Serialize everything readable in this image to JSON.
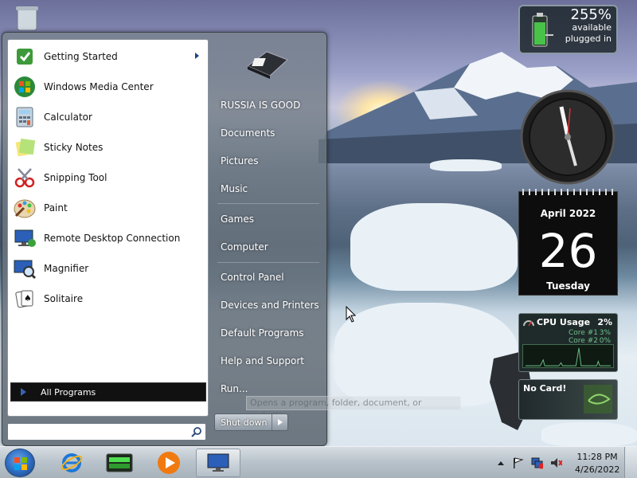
{
  "start_menu": {
    "programs": [
      {
        "label": "Getting Started",
        "icon": "getting-started-icon",
        "has_submenu": true
      },
      {
        "label": "Windows Media Center",
        "icon": "media-center-icon",
        "has_submenu": false
      },
      {
        "label": "Calculator",
        "icon": "calculator-icon",
        "has_submenu": false
      },
      {
        "label": "Sticky Notes",
        "icon": "sticky-notes-icon",
        "has_submenu": false
      },
      {
        "label": "Snipping Tool",
        "icon": "scissors-icon",
        "has_submenu": false
      },
      {
        "label": "Paint",
        "icon": "paint-palette-icon",
        "has_submenu": false
      },
      {
        "label": "Remote Desktop Connection",
        "icon": "remote-desktop-icon",
        "has_submenu": false
      },
      {
        "label": "Magnifier",
        "icon": "magnifier-icon",
        "has_submenu": false
      },
      {
        "label": "Solitaire",
        "icon": "playing-cards-icon",
        "has_submenu": false
      }
    ],
    "all_programs_label": "All Programs",
    "search_placeholder": "",
    "right_items": [
      {
        "label": "RUSSIA IS GOOD",
        "name": "user-name"
      },
      {
        "label": "Documents",
        "name": "documents"
      },
      {
        "label": "Pictures",
        "name": "pictures"
      },
      {
        "label": "Music",
        "name": "music"
      },
      {
        "label": "Games",
        "name": "games"
      },
      {
        "label": "Computer",
        "name": "computer"
      },
      {
        "label": "Control Panel",
        "name": "control-panel"
      },
      {
        "label": "Devices and Printers",
        "name": "devices-and-printers"
      },
      {
        "label": "Default Programs",
        "name": "default-programs"
      },
      {
        "label": "Help and Support",
        "name": "help-and-support"
      },
      {
        "label": "Run...",
        "name": "run"
      }
    ],
    "shutdown_label": "Shut down",
    "run_tooltip": "Opens a program, folder, document, or website."
  },
  "gadgets": {
    "battery": {
      "percent": "255%",
      "status1": "available",
      "status2": "plugged in"
    },
    "calendar": {
      "month_year": "April 2022",
      "day": "26",
      "weekday": "Tuesday"
    },
    "cpu": {
      "title": "CPU Usage",
      "total": "2%",
      "core1_label": "Core #1",
      "core1_value": "3%",
      "core2_label": "Core #2",
      "core2_value": "0%"
    },
    "gpu": {
      "label": "No Card!"
    }
  },
  "taskbar": {
    "time": "11:28 PM",
    "date": "4/26/2022",
    "pinned": [
      "internet-explorer-icon",
      "terminal-icon",
      "media-player-icon",
      "remote-desktop-icon"
    ]
  },
  "colors": {
    "start_orb": "#2f6fc3",
    "all_programs_bg": "#111111",
    "calendar_bg": "#0d0d0d",
    "cpu_text": "#6ec38a"
  }
}
